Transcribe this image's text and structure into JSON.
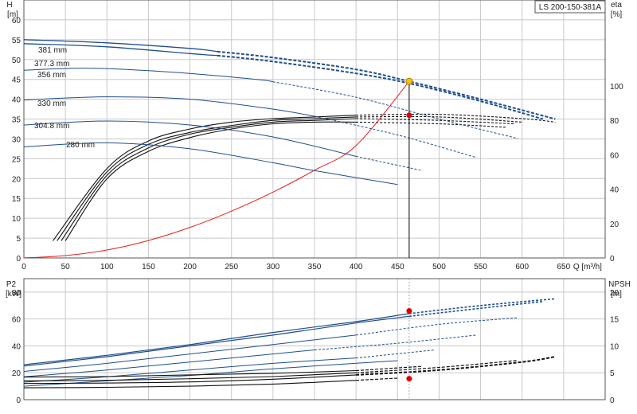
{
  "chart_data": [
    {
      "type": "line",
      "model_label": "LS 200-150-381A",
      "xlabel": "Q [m³/h]",
      "ylabel_left": [
        "H",
        "[m]"
      ],
      "ylabel_right": [
        "eta",
        "[%]"
      ],
      "xlim": [
        0,
        700
      ],
      "ylim_left": [
        0,
        65
      ],
      "ylim_right": [
        0,
        150
      ],
      "x_ticks": [
        0,
        50,
        100,
        150,
        200,
        250,
        300,
        350,
        400,
        450,
        500,
        550,
        600,
        650
      ],
      "y_ticks_left": [
        0,
        5,
        10,
        15,
        20,
        25,
        30,
        35,
        40,
        45,
        50,
        55,
        60
      ],
      "y_ticks_right": [
        0,
        20,
        40,
        60,
        80,
        100
      ],
      "grid": true,
      "head_series": [
        {
          "name": "381 mm",
          "solid": [
            [
              0,
              55.0
            ],
            [
              100,
              54.2
            ],
            [
              200,
              52.8
            ],
            [
              233,
              52.0
            ]
          ],
          "dashed": [
            [
              233,
              52.0
            ],
            [
              300,
              50.5
            ],
            [
              400,
              47.5
            ],
            [
              464,
              44.5
            ],
            [
              550,
              40.0
            ],
            [
              640,
              35.0
            ]
          ]
        },
        {
          "name": "377.3 mm",
          "solid": [
            [
              0,
              54.0
            ],
            [
              100,
              53.2
            ],
            [
              200,
              51.5
            ],
            [
              233,
              51.0
            ]
          ],
          "dashed": [
            [
              233,
              51.0
            ],
            [
              300,
              49.5
            ],
            [
              400,
              46.5
            ],
            [
              464,
              44.0
            ],
            [
              550,
              39.5
            ],
            [
              625,
              35.0
            ]
          ]
        },
        {
          "name": "356 mm",
          "solid": [
            [
              0,
              47.3
            ],
            [
              80,
              47.8
            ],
            [
              180,
              46.8
            ],
            [
              280,
              45.0
            ],
            [
              300,
              44.4
            ]
          ],
          "dashed": [
            [
              300,
              44.4
            ],
            [
              400,
              40.5
            ],
            [
              500,
              35.0
            ],
            [
              595,
              30.1
            ]
          ]
        },
        {
          "name": "330 mm",
          "solid": [
            [
              0,
              39.8
            ],
            [
              100,
              40.6
            ],
            [
              200,
              40.0
            ],
            [
              300,
              37.5
            ],
            [
              350,
              35.7
            ]
          ],
          "dashed": [
            [
              350,
              35.7
            ],
            [
              450,
              31.0
            ],
            [
              545,
              25.3
            ]
          ]
        },
        {
          "name": "304.8 mm",
          "solid": [
            [
              0,
              33.5
            ],
            [
              100,
              34.5
            ],
            [
              200,
              33.5
            ],
            [
              300,
              30.5
            ],
            [
              400,
              25.6
            ]
          ],
          "dashed": [
            [
              400,
              25.6
            ],
            [
              480,
              22.0
            ]
          ]
        },
        {
          "name": "280 mm",
          "solid": [
            [
              0,
              28.0
            ],
            [
              100,
              29.0
            ],
            [
              200,
              27.5
            ],
            [
              300,
              24.0
            ],
            [
              350,
              22.0
            ],
            [
              450,
              18.5
            ]
          ],
          "dashed": []
        }
      ],
      "system_curve": [
        [
          0,
          0
        ],
        [
          50,
          0.6
        ],
        [
          100,
          2.0
        ],
        [
          150,
          4.4
        ],
        [
          200,
          7.7
        ],
        [
          250,
          11.8
        ],
        [
          300,
          16.6
        ],
        [
          350,
          22.1
        ],
        [
          400,
          28.3
        ],
        [
          464,
          44.5
        ]
      ],
      "efficiency_series": [
        {
          "solid": [
            [
              35,
              10
            ],
            [
              100,
              52
            ],
            [
              150,
              68
            ],
            [
              200,
              75
            ],
            [
              250,
              79
            ],
            [
              300,
              81
            ],
            [
              350,
              82
            ],
            [
              400,
              83
            ]
          ],
          "dashed": [
            [
              400,
              83
            ],
            [
              500,
              83.5
            ],
            [
              600,
              81
            ],
            [
              640,
              79
            ]
          ]
        },
        {
          "solid": [
            [
              40,
              10
            ],
            [
              100,
              50
            ],
            [
              150,
              66
            ],
            [
              200,
              73
            ],
            [
              250,
              77
            ],
            [
              300,
              80
            ],
            [
              350,
              81
            ],
            [
              400,
              82
            ]
          ],
          "dashed": [
            [
              400,
              82
            ],
            [
              500,
              82
            ],
            [
              600,
              79
            ]
          ]
        },
        {
          "solid": [
            [
              45,
              10
            ],
            [
              100,
              48
            ],
            [
              150,
              64
            ],
            [
              200,
              72
            ],
            [
              250,
              76
            ],
            [
              300,
              79
            ],
            [
              350,
              80
            ],
            [
              400,
              81
            ]
          ],
          "dashed": [
            [
              400,
              81
            ],
            [
              500,
              80
            ],
            [
              590,
              78
            ]
          ]
        },
        {
          "solid": [
            [
              50,
              10
            ],
            [
              100,
              46
            ],
            [
              150,
              62
            ],
            [
              200,
              70
            ],
            [
              250,
              75
            ],
            [
              300,
              78
            ],
            [
              350,
              79
            ],
            [
              400,
              79
            ]
          ],
          "dashed": [
            [
              400,
              79
            ],
            [
              500,
              78
            ],
            [
              580,
              76
            ]
          ]
        }
      ],
      "duty_point": {
        "q": 464,
        "h": 44.5,
        "eta": 83
      },
      "curve_labels": [
        "381 mm",
        "377.3 mm",
        "356 mm",
        "330 mm",
        "304.8 mm",
        "280 mm"
      ]
    },
    {
      "type": "line",
      "ylabel_left": [
        "P2",
        "[kW]"
      ],
      "ylabel_right": [
        "NPSH",
        "[m]"
      ],
      "xlim": [
        0,
        700
      ],
      "ylim_left": [
        0,
        90
      ],
      "ylim_right": [
        0,
        22.5
      ],
      "y_ticks_left": [
        0,
        20,
        40,
        60,
        80
      ],
      "y_ticks_right": [
        0,
        5,
        10,
        15,
        20
      ],
      "grid": true,
      "power_series": [
        {
          "solid": [
            [
              0,
              26
            ],
            [
              100,
              33
            ],
            [
              200,
              41
            ],
            [
              300,
              50
            ],
            [
              400,
              58
            ],
            [
              464,
              64
            ]
          ],
          "dashed": [
            [
              464,
              64
            ],
            [
              550,
              70
            ],
            [
              640,
              75
            ]
          ]
        },
        {
          "solid": [
            [
              0,
              25
            ],
            [
              100,
              32
            ],
            [
              200,
              40
            ],
            [
              300,
              48
            ],
            [
              400,
              57
            ],
            [
              464,
              62
            ]
          ],
          "dashed": [
            [
              464,
              62
            ],
            [
              550,
              68
            ],
            [
              625,
              73
            ]
          ]
        },
        {
          "solid": [
            [
              0,
              21
            ],
            [
              100,
              27
            ],
            [
              200,
              34
            ],
            [
              300,
              41
            ],
            [
              400,
              48
            ]
          ],
          "dashed": [
            [
              400,
              48
            ],
            [
              500,
              56
            ],
            [
              595,
              61
            ]
          ]
        },
        {
          "solid": [
            [
              0,
              17
            ],
            [
              100,
              22
            ],
            [
              200,
              28
            ],
            [
              300,
              34
            ],
            [
              350,
              37
            ]
          ],
          "dashed": [
            [
              350,
              37
            ],
            [
              450,
              42
            ],
            [
              545,
              48
            ]
          ]
        },
        {
          "solid": [
            [
              0,
              13
            ],
            [
              100,
              17
            ],
            [
              200,
              22
            ],
            [
              300,
              27
            ],
            [
              400,
              31
            ]
          ],
          "dashed": [
            [
              400,
              31
            ],
            [
              495,
              37
            ]
          ]
        },
        {
          "solid": [
            [
              0,
              10
            ],
            [
              100,
              14
            ],
            [
              200,
              18
            ],
            [
              300,
              23
            ],
            [
              450,
              29
            ]
          ],
          "dashed": []
        }
      ],
      "npsh_series": [
        {
          "solid": [
            [
              0,
              3.0
            ],
            [
              100,
              3.1
            ],
            [
              200,
              3.3
            ],
            [
              300,
              3.8
            ],
            [
              400,
              4.6
            ]
          ],
          "dashed": [
            [
              400,
              4.6
            ],
            [
              500,
              5.5
            ],
            [
              600,
              7.0
            ],
            [
              640,
              8.0
            ]
          ]
        },
        {
          "solid": [
            [
              0,
              3.5
            ],
            [
              100,
              3.6
            ],
            [
              200,
              3.9
            ],
            [
              300,
              4.3
            ],
            [
              400,
              5.0
            ]
          ],
          "dashed": [
            [
              400,
              5.0
            ],
            [
              500,
              6.0
            ],
            [
              595,
              7.3
            ]
          ]
        },
        {
          "solid": [
            [
              0,
              4.2
            ],
            [
              100,
              4.3
            ],
            [
              200,
              4.6
            ],
            [
              300,
              4.9
            ],
            [
              400,
              5.4
            ]
          ],
          "dashed": [
            [
              400,
              5.4
            ],
            [
              480,
              6.2
            ]
          ]
        },
        {
          "solid": [
            [
              0,
              2.2
            ],
            [
              100,
              2.3
            ],
            [
              200,
              2.5
            ],
            [
              300,
              2.9
            ],
            [
              400,
              3.6
            ]
          ],
          "dashed": [
            [
              400,
              3.6
            ],
            [
              450,
              4.0
            ]
          ]
        }
      ],
      "duty_point": {
        "q": 464,
        "p2": 66,
        "npsh": 3.9
      }
    }
  ],
  "colors": {
    "curve": "#1f4e8c",
    "system": "#e02020",
    "efficiency": "#111111",
    "duty_marker_fill": "#f5c400",
    "red_marker": "#e00000"
  }
}
